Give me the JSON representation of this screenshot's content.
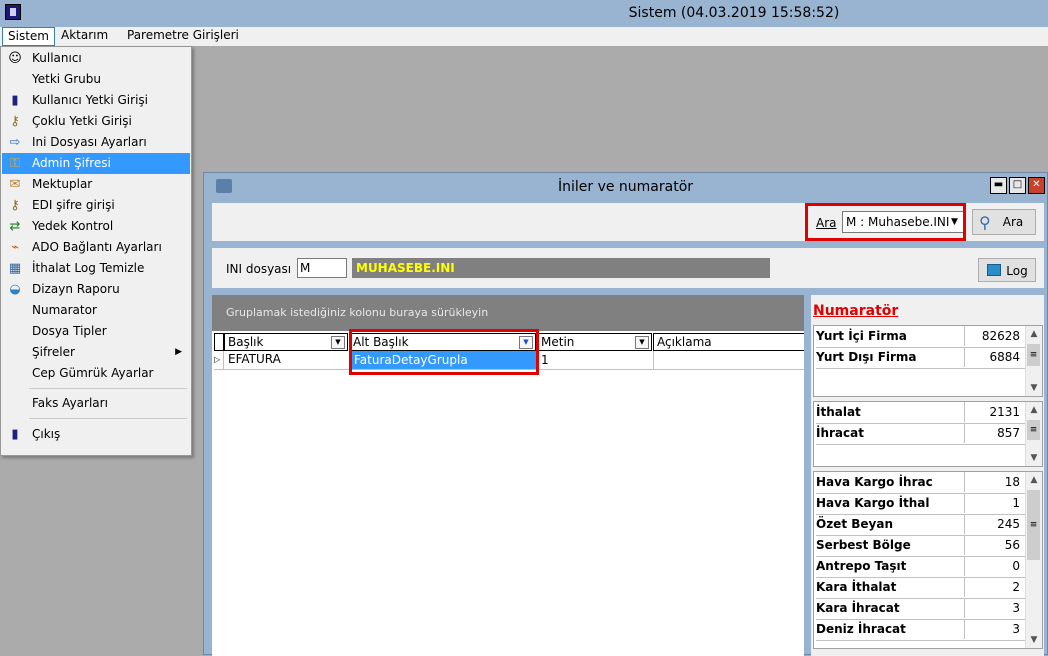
{
  "window": {
    "title": "Sistem (04.03.2019 15:58:52)"
  },
  "menubar": [
    "Sistem",
    "Aktarım",
    "Paremetre Girişleri"
  ],
  "dropdown": {
    "items": [
      {
        "label": "Kullanıcı",
        "icon": "user-icon"
      },
      {
        "label": "Yetki Grubu",
        "icon": ""
      },
      {
        "label": "Kullanıcı Yetki Girişi",
        "icon": "door-icon"
      },
      {
        "label": "Çoklu Yetki Girişi",
        "icon": "users-key-icon"
      },
      {
        "label": "Ini Dosyası  Ayarları",
        "icon": "file-arrow-icon"
      },
      {
        "label": "Admin Şifresi",
        "icon": "key-icon"
      },
      {
        "label": "Mektuplar",
        "icon": "letter-icon"
      },
      {
        "label": "EDI şifre girişi",
        "icon": "users-key-icon"
      },
      {
        "label": "Yedek Kontrol",
        "icon": "backup-icon"
      },
      {
        "label": "ADO Bağlantı Ayarları",
        "icon": "connection-icon"
      },
      {
        "label": "İthalat Log Temizle",
        "icon": "log-clean-icon"
      },
      {
        "label": "Dizayn Raporu",
        "icon": "report-icon"
      },
      {
        "label": "Numarator",
        "icon": ""
      },
      {
        "label": "Dosya Tipler",
        "icon": ""
      },
      {
        "label": "Şifreler",
        "icon": "",
        "submenu": true
      },
      {
        "label": "Cep Gümrük Ayarlar",
        "icon": ""
      },
      {
        "label": "Faks Ayarları",
        "icon": ""
      },
      {
        "label": "Çıkış",
        "icon": "door-icon"
      }
    ],
    "highlighted_index": 5
  },
  "child": {
    "title": "İniler ve numaratör",
    "search_label": "Ara",
    "search_value": "M : Muhasebe.INI",
    "search_button": "Ara",
    "ini_label": "INI dosyası",
    "ini_value": "M",
    "ini_name": "MUHASEBE.INI",
    "log_button": "Log",
    "group_hint": "Gruplamak istediğiniz kolonu buraya sürükleyin",
    "columns": [
      "Başlık",
      "Alt Başlık",
      "Metin",
      "Açıklama"
    ],
    "rows": [
      {
        "baslik": "EFATURA",
        "alt": "FaturaDetayGrupla",
        "metin": "1",
        "aciklama": ""
      }
    ]
  },
  "numarator": {
    "title": "Numaratör",
    "group1": [
      {
        "label": "Yurt İçi Firma",
        "value": "82628"
      },
      {
        "label": "Yurt Dışı Firma",
        "value": "6884"
      }
    ],
    "group2": [
      {
        "label": "İthalat",
        "value": "2131"
      },
      {
        "label": "İhracat",
        "value": "857"
      }
    ],
    "group3": [
      {
        "label": "Hava Kargo İhrac",
        "value": "18"
      },
      {
        "label": "Hava Kargo İthal",
        "value": "1"
      },
      {
        "label": "Özet Beyan",
        "value": "245"
      },
      {
        "label": "Serbest Bölge",
        "value": "56"
      },
      {
        "label": "Antrepo Taşıt",
        "value": "0"
      },
      {
        "label": "Kara İthalat",
        "value": "2"
      },
      {
        "label": "Kara İhracat",
        "value": "3"
      },
      {
        "label": "Deniz İhracat",
        "value": "3"
      }
    ]
  },
  "colors": {
    "titlebar": "#99b4d1",
    "highlight": "#3399ff",
    "annotation": "#e00000",
    "ini_name_text": "#ffff00"
  }
}
